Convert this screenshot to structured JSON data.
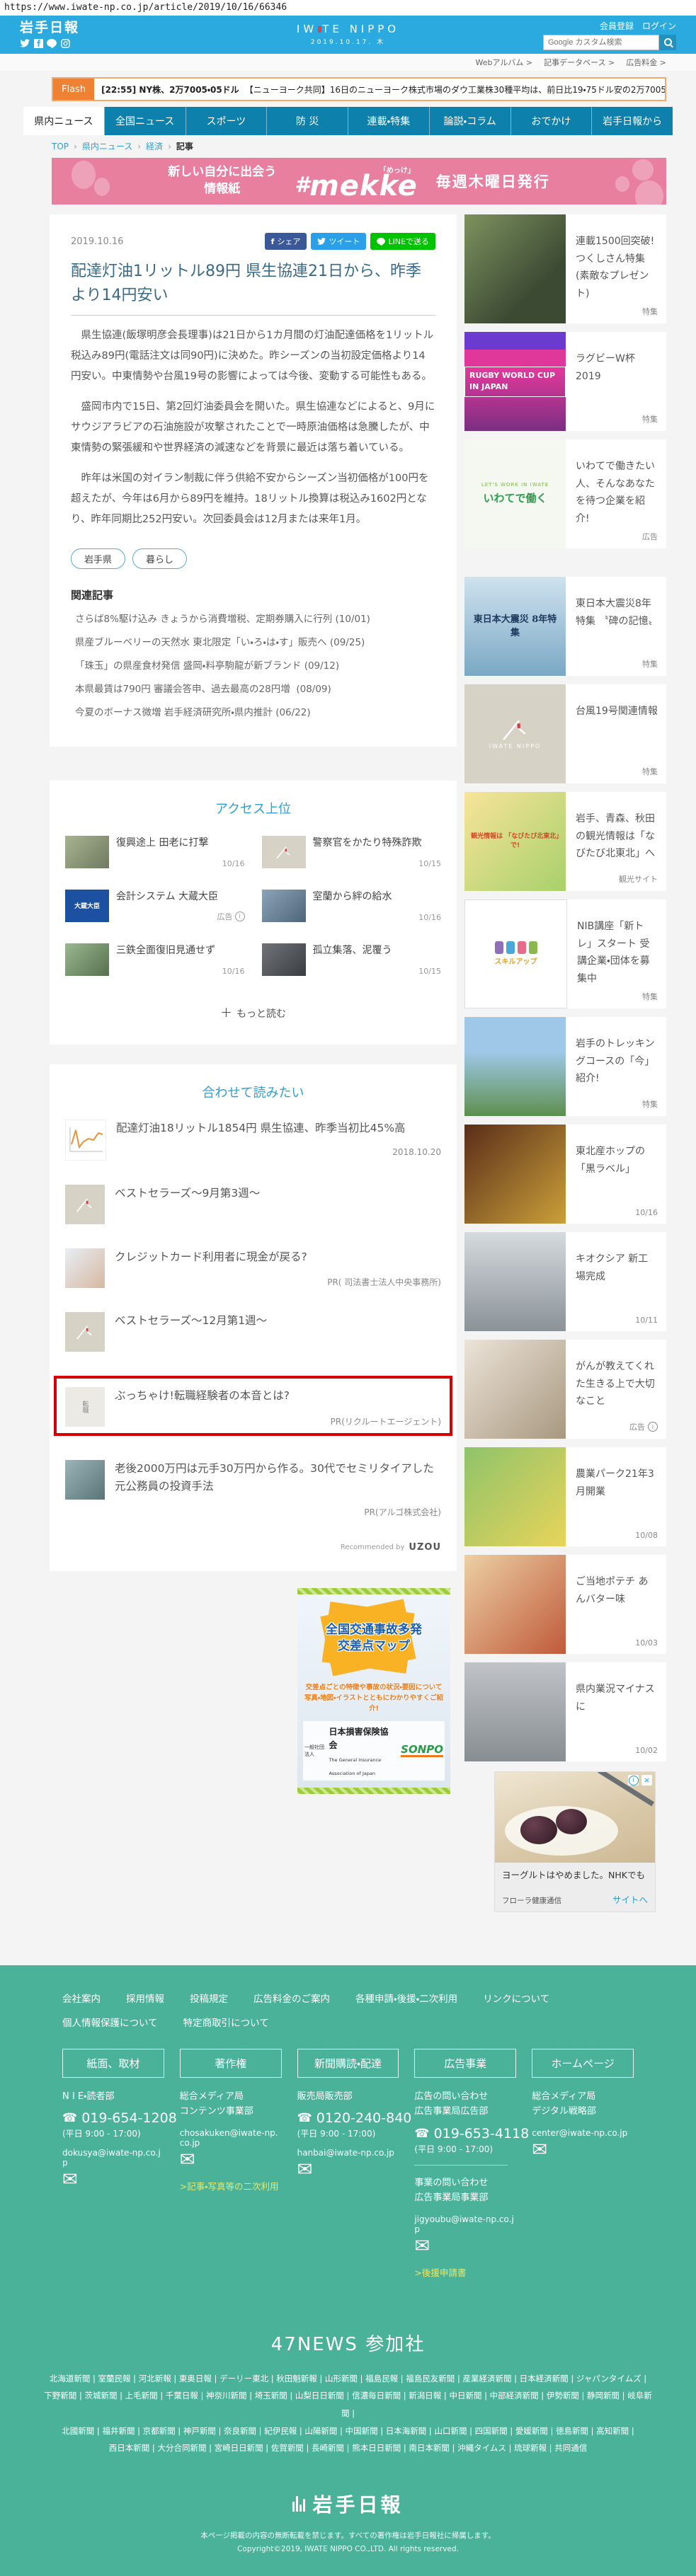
{
  "page": {
    "url": "https://www.iwate-np.co.jp/article/2019/10/16/66346"
  },
  "colors": {
    "header_blue": "#2aaade",
    "nav_blue": "#0d80ab",
    "banner_pink": "#e87f9f",
    "accent_blue": "#2f9fd3",
    "footer_teal": "#49b299",
    "flash_orange": "#ef8232",
    "annotation_red": "#d60000",
    "facebook": "#3b5998",
    "twitter": "#2b9fe8",
    "line_green": "#00c300"
  },
  "icons": {
    "phone": "☎",
    "mail": "✉",
    "plus": "＋",
    "close": "×",
    "info": "i"
  },
  "header": {
    "brand": "岩手日報",
    "logo_left": "IW",
    "logo_right": "TE NIPPO",
    "logo_date": "2019.10.17. 木",
    "member_link": "会員登録",
    "login_link": "ログイン",
    "search_placeholder": "Google カスタム検索",
    "sublinks": [
      {
        "label": "Webアルバム >"
      },
      {
        "label": "記事データベース >"
      },
      {
        "label": "広告料金 >"
      }
    ]
  },
  "ticker": {
    "badge": "Flash",
    "lead": "[22:55] NY株、2万7005・05ドル",
    "body": "【ニューヨーク共同】16日のニューヨーク株式市場のダウ工業株30種平均は、前日比19・75ドル安の2万7005…"
  },
  "nav": {
    "items": [
      {
        "label": "県内ニュース"
      },
      {
        "label": "全国ニュース"
      },
      {
        "label": "スポーツ"
      },
      {
        "label": "防 災"
      },
      {
        "label": "連載・特集"
      },
      {
        "label": "論説・コラム"
      },
      {
        "label": "おでかけ"
      },
      {
        "label": "岩手日報から"
      }
    ]
  },
  "breadcrumb": {
    "items": [
      {
        "label": "TOP"
      },
      {
        "label": "県内ニュース"
      },
      {
        "label": "経済"
      },
      {
        "label": "記事"
      }
    ]
  },
  "banner": {
    "catch": "新しい自分に出会う\n情報紙",
    "hash": "#",
    "name": "mekke",
    "ruby": "「めっけ」",
    "issue": "毎週木曜日発行"
  },
  "article": {
    "date": "2019.10.16",
    "share_facebook": "シェア",
    "share_twitter": "ツイート",
    "share_line": "LINEで送る",
    "title": "配達灯油1リットル89円 県生協連21日から、昨季より14円安い",
    "paragraphs": [
      "県生協連(飯塚明彦会長理事)は21日から1カ月間の灯油配達価格を1リットル税込み89円(電話注文は同90円)に決めた。昨シーズンの当初設定価格より14円安い。中東情勢や台風19号の影響によっては今後、変動する可能性もある。",
      "盛岡市内で15日、第2回灯油委員会を開いた。県生協連などによると、9月にサウジアラビアの石油施設が攻撃されたことで一時原油価格は急騰したが、中東情勢の緊張緩和や世界経済の減速などを背景に最近は落ち着いている。",
      "昨年は米国の対イラン制裁に伴う供給不安からシーズン当初価格が100円を超えたが、今年は6月から89円を維持。18リットル換算は税込み1602円となり、昨年同期比252円安い。次回委員会は12月または来年1月。"
    ],
    "tags": [
      {
        "label": "岩手県"
      },
      {
        "label": "暮らし"
      }
    ],
    "related_heading": "関連記事",
    "related": [
      {
        "title": "さらば8%駆け込み きょうから消費増税、定期券購入に行列",
        "date": "(10/01)"
      },
      {
        "title": "県産ブルーベリーの天然水 東北限定「い・ろ・は・す」販売へ",
        "date": "(09/25)"
      },
      {
        "title": "「珠玉」の県産食材発信 盛岡・料亭駒龍が新ブランド",
        "date": "(09/12)"
      },
      {
        "title": "本県最賃は790円 審議会答申、過去最高の28円増",
        "date": "(08/09)"
      },
      {
        "title": "今夏のボーナス微増 岩手経済研究所・県内推計",
        "date": "(06/22)"
      }
    ]
  },
  "access": {
    "heading": "アクセス上位",
    "items": [
      {
        "title": "復興途上 田老に打撃",
        "date": "10/16"
      },
      {
        "title": "警察官をかたり特殊詐欺",
        "date": "10/15"
      },
      {
        "title": "会計システム 大蔵大臣",
        "date": "広告",
        "thumb_text": "大蔵大臣"
      },
      {
        "title": "室蘭から絆の給水",
        "date": "10/16"
      },
      {
        "title": "三鉄全面復旧見通せず",
        "date": "10/16"
      },
      {
        "title": "孤立集落、泥覆う",
        "date": "10/15"
      }
    ],
    "more": "もっと読む"
  },
  "uzou": {
    "heading": "合わせて読みたい",
    "items": [
      {
        "title": "配達灯油18リットル1854円 県生協連、昨季当初比45%高",
        "meta": "2018.10.20"
      },
      {
        "title": "ベストセラーズ〜9月第3週〜",
        "meta": ""
      },
      {
        "title": "クレジットカード利用者に現金が戻る?",
        "meta": "PR( 司法書士法人中央事務所)"
      },
      {
        "title": "ベストセラーズ〜12月第1週〜",
        "meta": ""
      },
      {
        "title": "ぶっちゃけ!転職経験者の本音とは?",
        "meta": "PR(リクルートエージェント)"
      },
      {
        "title": "老後2000万円は元手30万円から作る。30代でセミリタイアした元公務員の投資手法",
        "meta": "PR(アルゴ株式会社)"
      }
    ],
    "recommended": "Recommended by",
    "brand": "UZOU"
  },
  "sonpo_ad": {
    "title": "全国交通事故多発\n交差点マップ",
    "desc1": "交差点ごとの特徴や事故の状況・要因について",
    "desc2": "写真・地図・イラストとともにわかりやすくご紹介!",
    "org_prefix": "一般社団法人",
    "org": "日本損害保険協会",
    "org_en": "The General Insurance Association of Japan",
    "brand": "SONPO"
  },
  "sidebar": {
    "items": [
      {
        "title": "連載1500回突破!つくしさん特集(素敵なプレゼント)",
        "tag": "特集"
      },
      {
        "title": "ラグビーW杯2019",
        "tag": "特集",
        "thumb_text": "RUGBY WORLD CUP IN JAPAN"
      },
      {
        "title": "いわてで働きたい人、そんなあなたを待つ企業を紹介!",
        "tag": "広告",
        "thumb_text": "いわてで働く",
        "thumb_sub": "LET'S WORK IN IWATE"
      },
      {
        "title": "東日本大震災8年特集 〝碑の記憶〟",
        "tag": "特集",
        "thumb_text": "東日本大震災 8年特集"
      },
      {
        "title": "台風19号関連情報",
        "tag": "特集",
        "thumb_text": "IWATE NIPPO"
      },
      {
        "title": "岩手、青森、秋田の観光情報は「なびたび北東北」へ",
        "tag": "観光サイト",
        "thumb_text": "観光情報は 「なびたび北東北」で!"
      },
      {
        "title": "NIB講座「新トレ」スタート 受講企業・団体を募集中",
        "tag": "特集",
        "thumb_text": "スキルアップ"
      },
      {
        "title": "岩手のトレッキングコースの「今」紹介!",
        "tag": "特集"
      },
      {
        "title": "東北産ホップの「黒ラベル」",
        "tag": "10/16"
      },
      {
        "title": "キオクシア 新工場完成",
        "tag": "10/11"
      },
      {
        "title": "がんが教えてくれた生きる上で大切なこと",
        "tag": "広告"
      },
      {
        "title": "農業パーク21年3月開業",
        "tag": "10/08"
      },
      {
        "title": "ご当地ポテチ あんバター味",
        "tag": "10/03"
      },
      {
        "title": "県内業況マイナスに",
        "tag": "10/02"
      }
    ]
  },
  "anchor_ad": {
    "text": "ヨーグルトはやめました。NHKでも",
    "brand": "フローラ健康通信",
    "link": "サイトへ"
  },
  "footer": {
    "links": [
      "会社案内",
      "採用情報",
      "投稿規定",
      "広告料金のご案内",
      "各種申請・後援・二次利用",
      "リンクについて",
      "個人情報保護について",
      "特定商取引について"
    ],
    "columns": [
      {
        "title": "紙面、取材",
        "dept": "N I E・読者部",
        "phone": "019-654-1208",
        "hours": "(平日 9:00 - 17:00)",
        "email": "dokusya@iwate-np.co.jp"
      },
      {
        "title": "著作権",
        "dept": "総合メディア局\nコンテンツ事業部",
        "email": "chosakuken@iwate-np.co.jp",
        "extra": ">記事・写真等の二次利用"
      },
      {
        "title": "新聞購読・配達",
        "dept": "販売局販売部",
        "phone": "0120-240-840",
        "hours": "(平日 9:00 - 17:00)",
        "email": "hanbai@iwate-np.co.jp"
      },
      {
        "title": "広告事業",
        "dept": "広告の問い合わせ\n広告事業局広告部",
        "phone": "019-653-4118",
        "hours": "(平日 9:00 - 17:00)",
        "dept2": "事業の問い合わせ\n広告事業局事業部",
        "email": "jigyoubu@iwate-np.co.jp",
        "extra": ">後援申請書"
      },
      {
        "title": "ホームページ",
        "dept": "総合メディア局\nデジタル戦略部",
        "email": "center@iwate-np.co.jp"
      }
    ],
    "news47_heading": "47NEWS 参加社",
    "news47_lines": [
      "北海道新聞 | 室蘭民報 | 河北新報 | 東奥日報 | デーリー東北 | 秋田魁新報 | 山形新聞 | 福島民報 | 福島民友新聞 | 産業経済新聞 | 日本経済新聞 | ジャパンタイムズ |",
      "下野新聞 | 茨城新聞 | 上毛新聞 | 千葉日報 | 神奈川新聞 | 埼玉新聞 | 山梨日日新聞 | 信濃毎日新聞 | 新潟日報 | 中日新聞 | 中部経済新聞 | 伊勢新聞 | 静岡新聞 | 岐阜新聞 |",
      "北國新聞 | 福井新聞 | 京都新聞 | 神戸新聞 | 奈良新聞 | 紀伊民報 | 山陽新聞 | 中国新聞 | 日本海新聞 | 山口新聞 | 四国新聞 | 愛媛新聞 | 徳島新聞 | 高知新聞 |",
      "西日本新聞 | 大分合同新聞 | 宮崎日日新聞 | 佐賀新聞 | 長崎新聞 | 熊本日日新聞 | 南日本新聞 | 沖縄タイムス | 琉球新報 | 共同通信"
    ],
    "logo": "岩手日報",
    "copyright1": "本ページ掲載の内容の無断転載を禁じます。すべての著作権は岩手日報社に帰属します。",
    "copyright2": "Copyright©2019, IWATE NIPPO CO.,LTD. All rights reserved."
  }
}
